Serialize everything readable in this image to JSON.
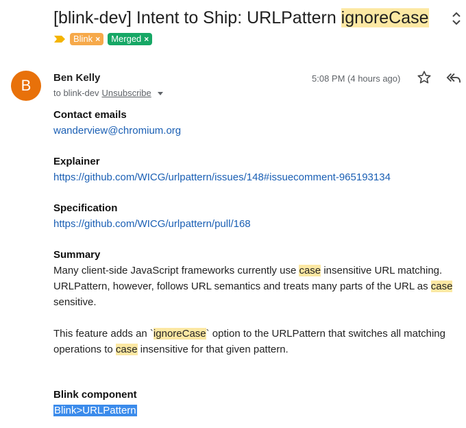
{
  "email": {
    "subject_prefix": "[blink-dev] Intent to Ship: URLPattern ",
    "subject_highlight": "ignoreCase",
    "labels": [
      {
        "text": "Blink",
        "color": "#f6a94a"
      },
      {
        "text": "Merged",
        "color": "#16a765"
      }
    ],
    "label_remove_glyph": "×",
    "avatar_letter": "B",
    "avatar_color": "#e8710a",
    "sender": "Ben Kelly",
    "to_prefix": "to blink-dev",
    "unsubscribe": "Unsubscribe",
    "time": "5:08 PM (4 hours ago)"
  },
  "body": {
    "contact_heading": "Contact emails",
    "contact_email": "wanderview@chromium.org",
    "explainer_heading": "Explainer",
    "explainer_link": "https://github.com/WICG/urlpattern/issues/148#issuecomment-965193134",
    "spec_heading": "Specification",
    "spec_link": "https://github.com/WICG/urlpattern/pull/168",
    "summary_heading": "Summary",
    "summary_p1_a": "Many client-side JavaScript frameworks currently use ",
    "summary_p1_case1": "case",
    "summary_p1_b": " insensitive URL matching. URLPattern, however, follows URL semantics and treats many parts of the URL as ",
    "summary_p1_case2": "case",
    "summary_p1_c": " sensitive.",
    "summary_p2_a": "This feature adds an `",
    "summary_p2_ignore": "ignoreCase",
    "summary_p2_b": "` option to the URLPattern that switches all matching operations to ",
    "summary_p2_case": "case",
    "summary_p2_c": " insensitive for that given pattern.",
    "component_heading": "Blink component",
    "component_value": "Blink>URLPattern"
  },
  "icons": {
    "expand": "unfold-more-icon",
    "importance": "importance-marker-icon",
    "caret": "caret-down-icon",
    "star": "star-icon",
    "reply": "reply-all-icon"
  },
  "colors": {
    "search_highlight": "#fce8a3",
    "selection": "#3b8beb",
    "link": "#1a5fb4"
  }
}
